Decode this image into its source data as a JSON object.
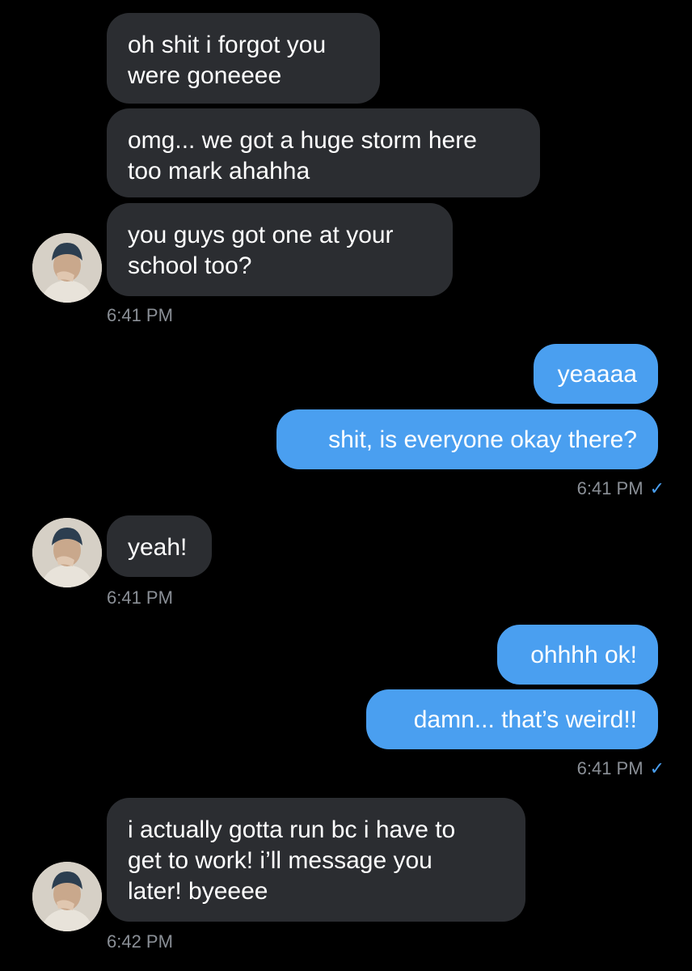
{
  "colors": {
    "background": "#000000",
    "incoming_bubble": "#2b2d31",
    "outgoing_bubble": "#4a9ff0",
    "timestamp": "#8a8f96",
    "read_check": "#4a9ff0"
  },
  "messages": [
    {
      "direction": "incoming",
      "text": "oh shit i forgot you\nwere goneeee"
    },
    {
      "direction": "incoming",
      "text": "omg... we got a huge storm here\ntoo mark ahahha"
    },
    {
      "direction": "incoming",
      "text": "you guys got one at your\nschool too?"
    },
    {
      "direction": "outgoing",
      "text": "yeaaaa"
    },
    {
      "direction": "outgoing",
      "text": "shit, is everyone okay there?"
    },
    {
      "direction": "incoming",
      "text": "yeah!"
    },
    {
      "direction": "outgoing",
      "text": "ohhhh ok!"
    },
    {
      "direction": "outgoing",
      "text": "damn... that’s weird!!"
    },
    {
      "direction": "incoming",
      "text": "i actually gotta run bc i have to\nget to work! i’ll message you\nlater! byeeee"
    }
  ],
  "timestamps": [
    {
      "text": "6:41 PM",
      "read_receipt": false
    },
    {
      "text": "6:41 PM",
      "read_receipt": true,
      "check_icon": "check-icon",
      "check_glyph": "✓"
    },
    {
      "text": "6:41 PM",
      "read_receipt": false
    },
    {
      "text": "6:41 PM",
      "read_receipt": true,
      "check_icon": "check-icon",
      "check_glyph": "✓"
    },
    {
      "text": "6:42 PM",
      "read_receipt": false
    }
  ],
  "avatar_icon": "user-avatar"
}
